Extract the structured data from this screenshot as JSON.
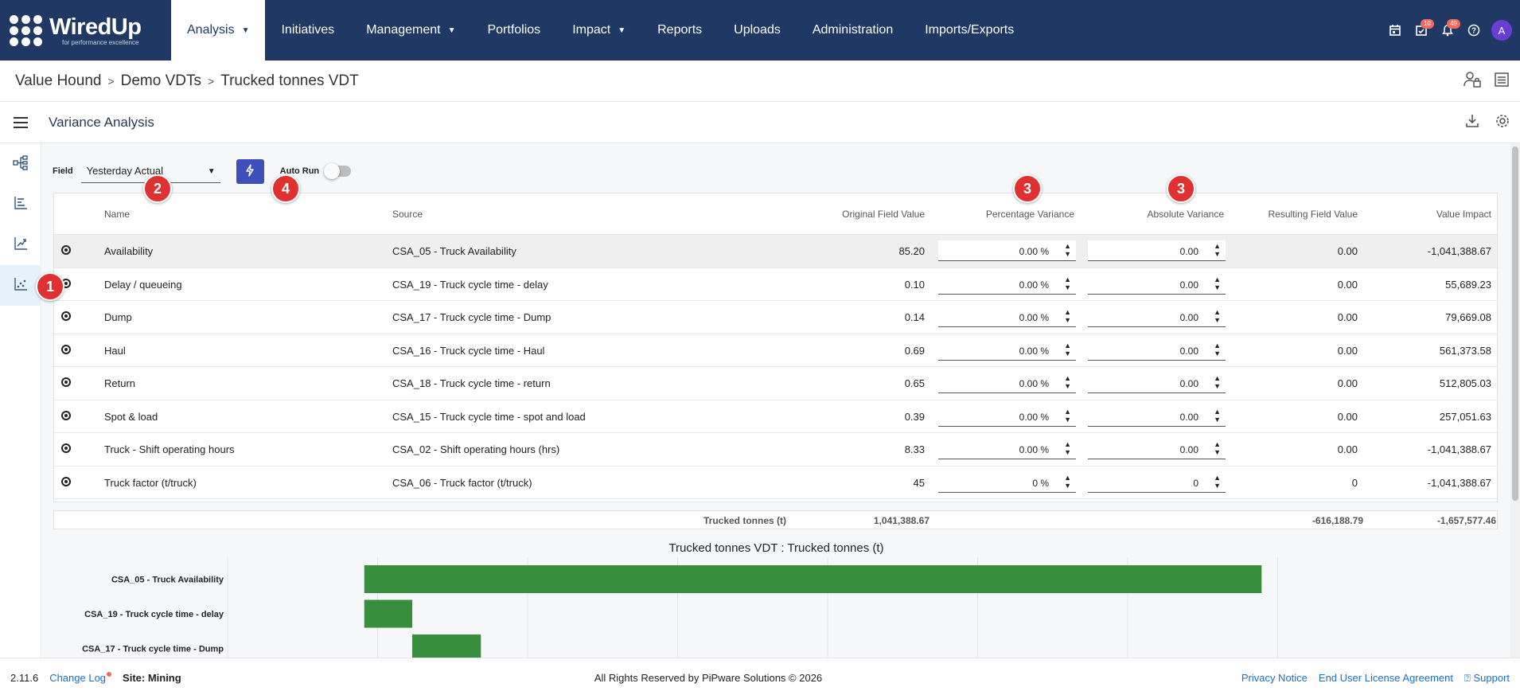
{
  "logo": {
    "name": "WiredUp",
    "tagline": "for performance excellence"
  },
  "nav": {
    "items": [
      {
        "label": "Analysis",
        "dropdown": true,
        "active": true
      },
      {
        "label": "Initiatives",
        "dropdown": false
      },
      {
        "label": "Management",
        "dropdown": true
      },
      {
        "label": "Portfolios",
        "dropdown": false
      },
      {
        "label": "Impact",
        "dropdown": true
      },
      {
        "label": "Reports",
        "dropdown": false
      },
      {
        "label": "Uploads",
        "dropdown": false
      },
      {
        "label": "Administration",
        "dropdown": false
      },
      {
        "label": "Imports/Exports",
        "dropdown": false
      }
    ],
    "icons": [
      {
        "icon": "calendar-icon"
      },
      {
        "icon": "task-check-icon",
        "badge": "10"
      },
      {
        "icon": "bell-icon",
        "badge": "49"
      },
      {
        "icon": "help-icon"
      }
    ],
    "avatar": "A"
  },
  "breadcrumb": [
    "Value Hound",
    "Demo VDTs",
    "Trucked tonnes VDT"
  ],
  "page": {
    "title": "Variance Analysis"
  },
  "controls": {
    "field_label": "Field",
    "field_value": "Yesterday Actual",
    "autorun_label": "Auto Run",
    "autorun_on": false
  },
  "callouts": {
    "c1": "1",
    "c2": "2",
    "c3a": "3",
    "c3b": "3",
    "c4": "4"
  },
  "table": {
    "headers": {
      "name": "Name",
      "source": "Source",
      "original": "Original Field Value",
      "pct": "Percentage Variance",
      "abs": "Absolute Variance",
      "result": "Resulting Field Value",
      "impact": "Value Impact"
    },
    "rows": [
      {
        "name": "Availability",
        "source": "CSA_05 - Truck Availability",
        "original": "85.20",
        "pct": "0.00 %",
        "abs": "0.00",
        "result": "0.00",
        "impact": "-1,041,388.67"
      },
      {
        "name": "Delay / queueing",
        "source": "CSA_19 - Truck cycle time - delay",
        "original": "0.10",
        "pct": "0.00 %",
        "abs": "0.00",
        "result": "0.00",
        "impact": "55,689.23"
      },
      {
        "name": "Dump",
        "source": "CSA_17 - Truck cycle time - Dump",
        "original": "0.14",
        "pct": "0.00 %",
        "abs": "0.00",
        "result": "0.00",
        "impact": "79,669.08"
      },
      {
        "name": "Haul",
        "source": "CSA_16 - Truck cycle time - Haul",
        "original": "0.69",
        "pct": "0.00 %",
        "abs": "0.00",
        "result": "0.00",
        "impact": "561,373.58"
      },
      {
        "name": "Return",
        "source": "CSA_18 - Truck cycle time - return",
        "original": "0.65",
        "pct": "0.00 %",
        "abs": "0.00",
        "result": "0.00",
        "impact": "512,805.03"
      },
      {
        "name": "Spot & load",
        "source": "CSA_15 - Truck cycle time - spot and load",
        "original": "0.39",
        "pct": "0.00 %",
        "abs": "0.00",
        "result": "0.00",
        "impact": "257,051.63"
      },
      {
        "name": "Truck - Shift operating hours",
        "source": "CSA_02 - Shift operating hours (hrs)",
        "original": "8.33",
        "pct": "0.00 %",
        "abs": "0.00",
        "result": "0.00",
        "impact": "-1,041,388.67"
      },
      {
        "name": "Truck factor (t/truck)",
        "source": "CSA_06 - Truck factor (t/truck)",
        "original": "45",
        "pct": "0 %",
        "abs": "0",
        "result": "0",
        "impact": "-1,041,388.67"
      }
    ],
    "totals": {
      "label": "Trucked tonnes (t)",
      "original": "1,041,388.67",
      "result": "-616,188.79",
      "impact": "-1,657,577.46"
    }
  },
  "chart_data": {
    "type": "bar",
    "orientation": "horizontal-waterfall",
    "title": "Trucked tonnes VDT  : Trucked tonnes (t)",
    "categories": [
      "CSA_05 - Truck Availability",
      "CSA_19 - Truck cycle time - delay",
      "CSA_17 - Truck cycle time - Dump"
    ],
    "values": [
      -1041388.67,
      55689.23,
      79669.08
    ],
    "bar_color": "#388e3c",
    "grid": true
  },
  "footer": {
    "version": "2.11.6",
    "changelog": "Change Log",
    "site": "Site: Mining",
    "copyright": "All Rights Reserved by PiPware Solutions © 2026",
    "privacy": "Privacy Notice",
    "eula": "End User License Agreement",
    "support": "Support"
  }
}
